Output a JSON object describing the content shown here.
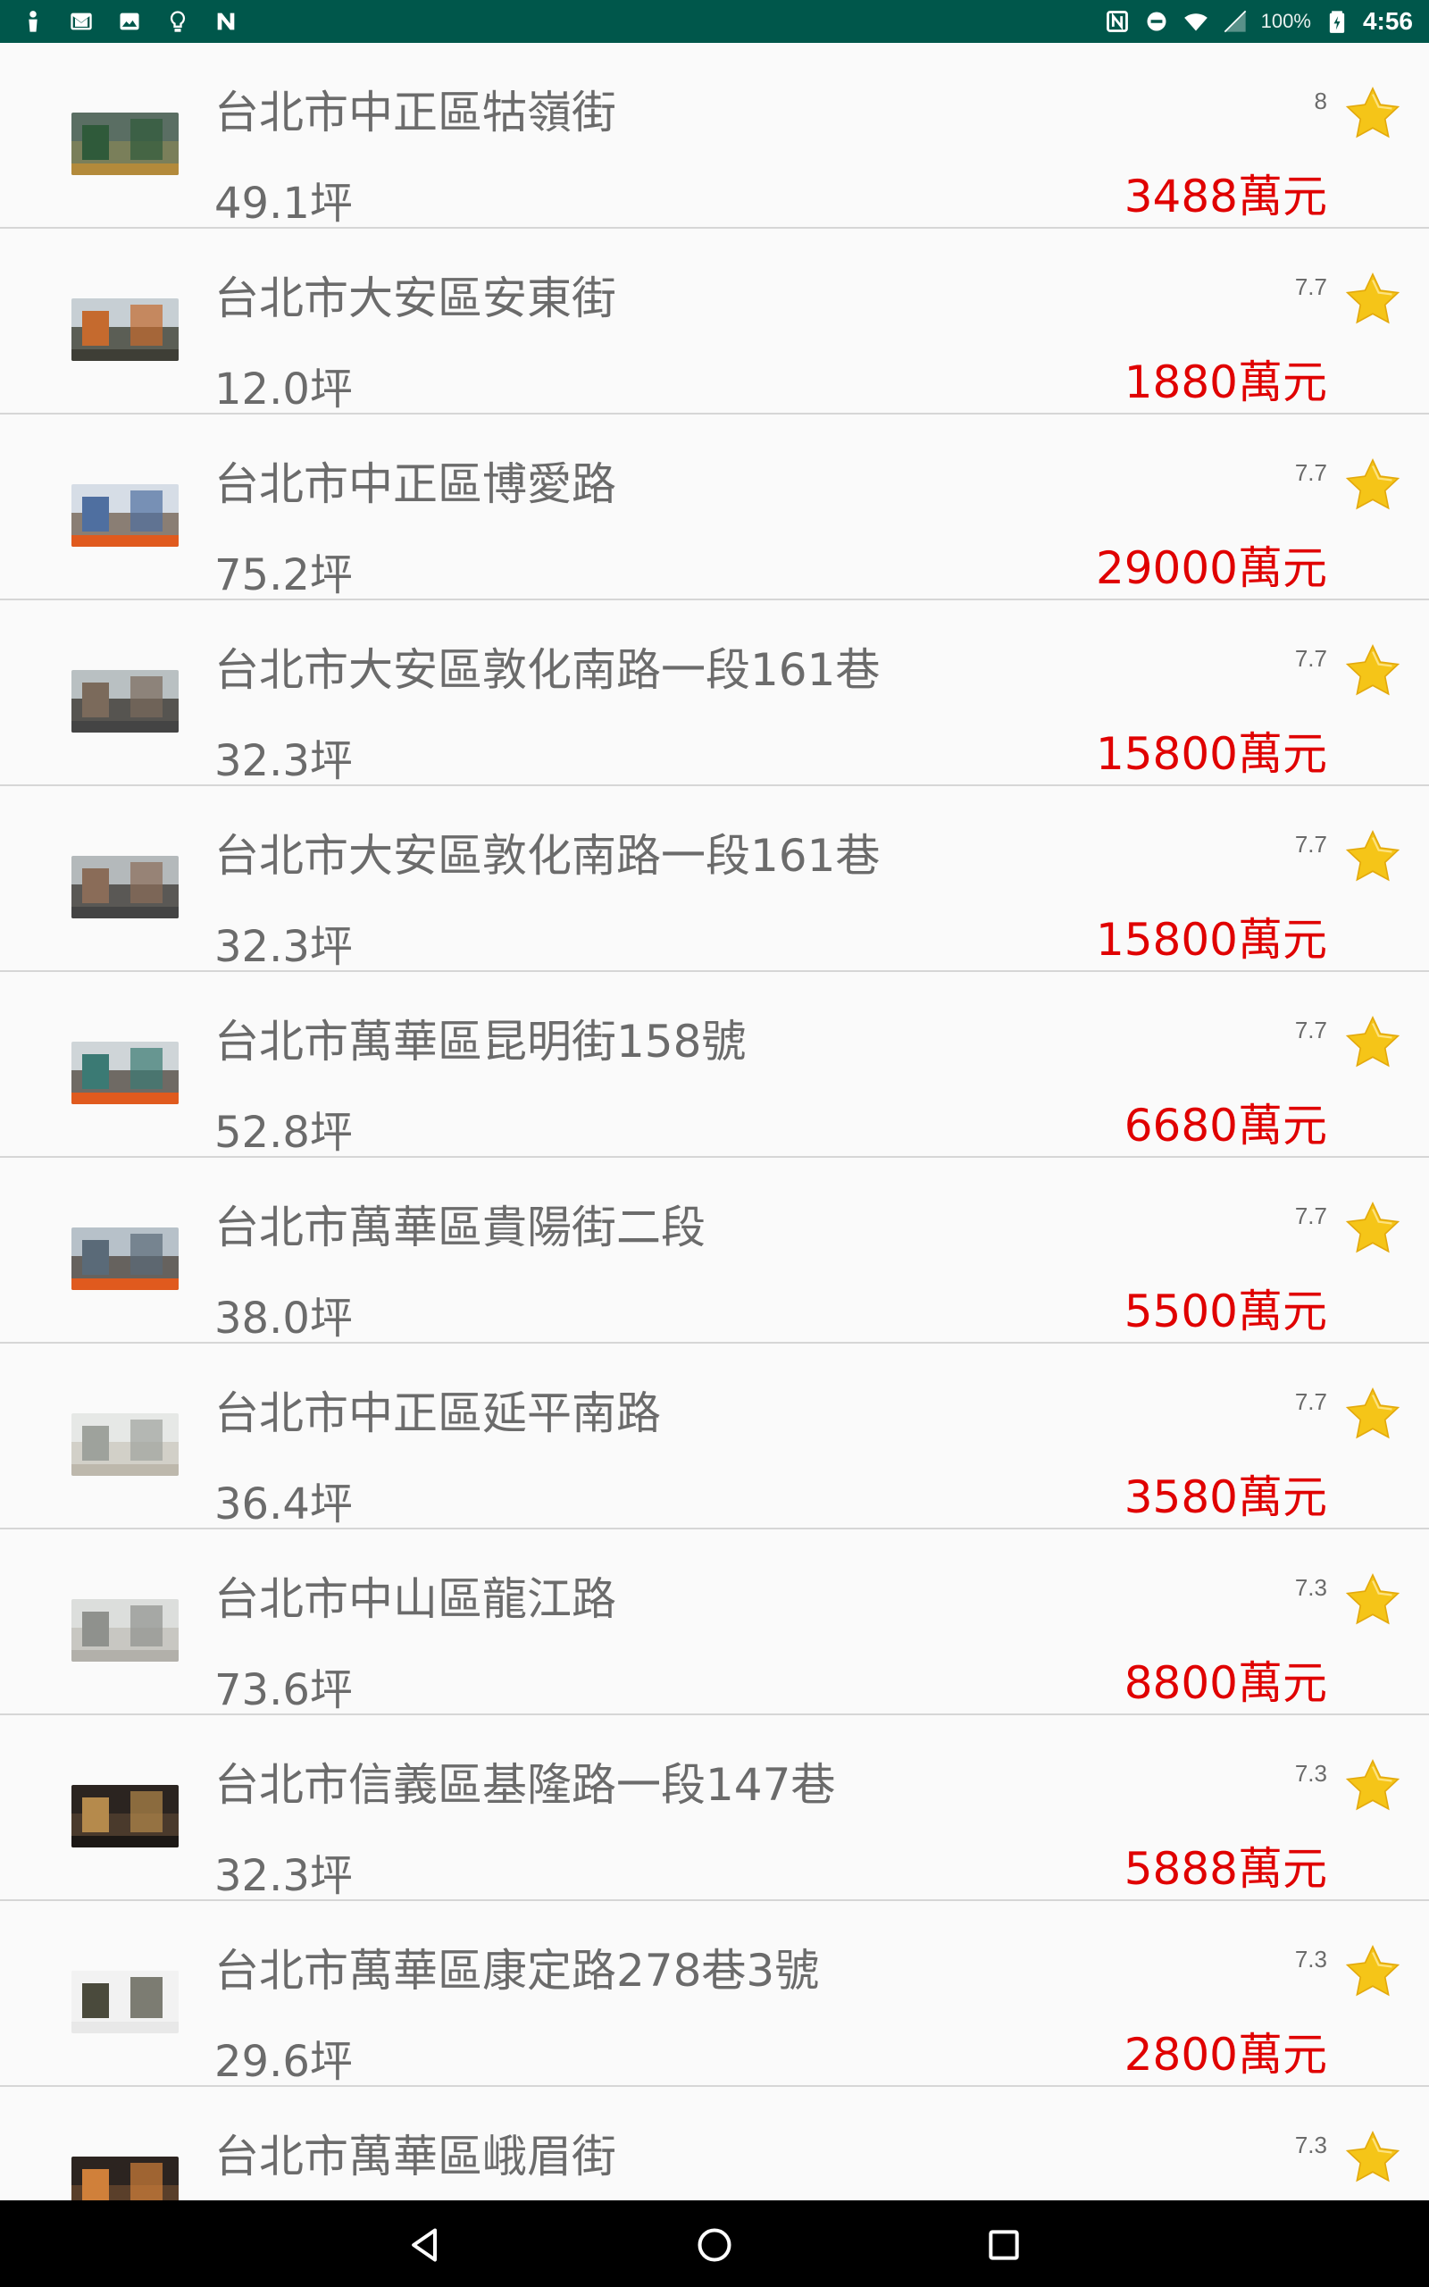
{
  "status_bar": {
    "left_icons": [
      "person-icon",
      "mail-icon",
      "image-icon",
      "lightbulb-icon",
      "n-app-icon"
    ],
    "right_icons": [
      "nfc-icon",
      "do-not-disturb-icon",
      "wifi-icon",
      "signal-icon"
    ],
    "battery_percent": "100%",
    "time": "4:56"
  },
  "listings": [
    {
      "address": "台北市中正區牯嶺街",
      "size": "49.1坪",
      "score": "8",
      "price": "3488萬元",
      "thumb": {
        "sky": "#5a6e63",
        "ground": "#7a7f5a",
        "accent": "#2f5a3a",
        "strip": "#b38a3b"
      }
    },
    {
      "address": "台北市大安區安東街",
      "size": "12.0坪",
      "score": "7.7",
      "price": "1880萬元",
      "thumb": {
        "sky": "#c7cfd4",
        "ground": "#5b5e55",
        "accent": "#c56a2e",
        "strip": "#3e3e36"
      }
    },
    {
      "address": "台北市中正區博愛路",
      "size": "75.2坪",
      "score": "7.7",
      "price": "29000萬元",
      "thumb": {
        "sky": "#d6dde6",
        "ground": "#8a7e74",
        "accent": "#4f6fa0",
        "strip": "#e05a1e"
      }
    },
    {
      "address": "台北市大安區敦化南路一段161巷",
      "size": "32.3坪",
      "score": "7.7",
      "price": "15800萬元",
      "thumb": {
        "sky": "#b9c0c2",
        "ground": "#565450",
        "accent": "#7b6a5b",
        "strip": "#444444"
      }
    },
    {
      "address": "台北市大安區敦化南路一段161巷",
      "size": "32.3坪",
      "score": "7.7",
      "price": "15800萬元",
      "thumb": {
        "sky": "#b4b9bb",
        "ground": "#5a5855",
        "accent": "#8a6c58",
        "strip": "#444444"
      }
    },
    {
      "address": "台北市萬華區昆明街158號",
      "size": "52.8坪",
      "score": "7.7",
      "price": "6680萬元",
      "thumb": {
        "sky": "#cfd5d8",
        "ground": "#6f6a64",
        "accent": "#3b7a74",
        "strip": "#e05a1e"
      }
    },
    {
      "address": "台北市萬華區貴陽街二段",
      "size": "38.0坪",
      "score": "7.7",
      "price": "5500萬元",
      "thumb": {
        "sky": "#b7c1c9",
        "ground": "#66625e",
        "accent": "#5a6a78",
        "strip": "#e05a1e"
      }
    },
    {
      "address": "台北市中正區延平南路",
      "size": "36.4坪",
      "score": "7.7",
      "price": "3580萬元",
      "thumb": {
        "sky": "#e6e8e6",
        "ground": "#d2d0c8",
        "accent": "#9ea29c",
        "strip": "#bdb8ac"
      }
    },
    {
      "address": "台北市中山區龍江路",
      "size": "73.6坪",
      "score": "7.3",
      "price": "8800萬元",
      "thumb": {
        "sky": "#dcdedc",
        "ground": "#c8c7c2",
        "accent": "#8f918d",
        "strip": "#b2b0aa"
      }
    },
    {
      "address": "台北市信義區基隆路一段147巷",
      "size": "32.3坪",
      "score": "7.3",
      "price": "5888萬元",
      "thumb": {
        "sky": "#2b2420",
        "ground": "#4a3a2c",
        "accent": "#b58a4c",
        "strip": "#1c1815"
      }
    },
    {
      "address": "台北市萬華區康定路278巷3號",
      "size": "29.6坪",
      "score": "7.3",
      "price": "2800萬元",
      "thumb": {
        "sky": "#f2f2f2",
        "ground": "#f2f2f2",
        "accent": "#4a4a3c",
        "strip": "#e8e8e8"
      }
    },
    {
      "address": "台北市萬華區峨眉街",
      "size": "",
      "score": "7.3",
      "price": "",
      "thumb": {
        "sky": "#2c2420",
        "ground": "#5a3f2a",
        "accent": "#d0803a",
        "strip": "#3a2c24"
      }
    }
  ],
  "colors": {
    "status_bar": "#00574B",
    "price": "#e00000",
    "text": "#6b6b6b",
    "star": "#f5c518"
  },
  "nav_bar": {
    "buttons": [
      "back-icon",
      "home-icon",
      "recents-icon"
    ]
  }
}
